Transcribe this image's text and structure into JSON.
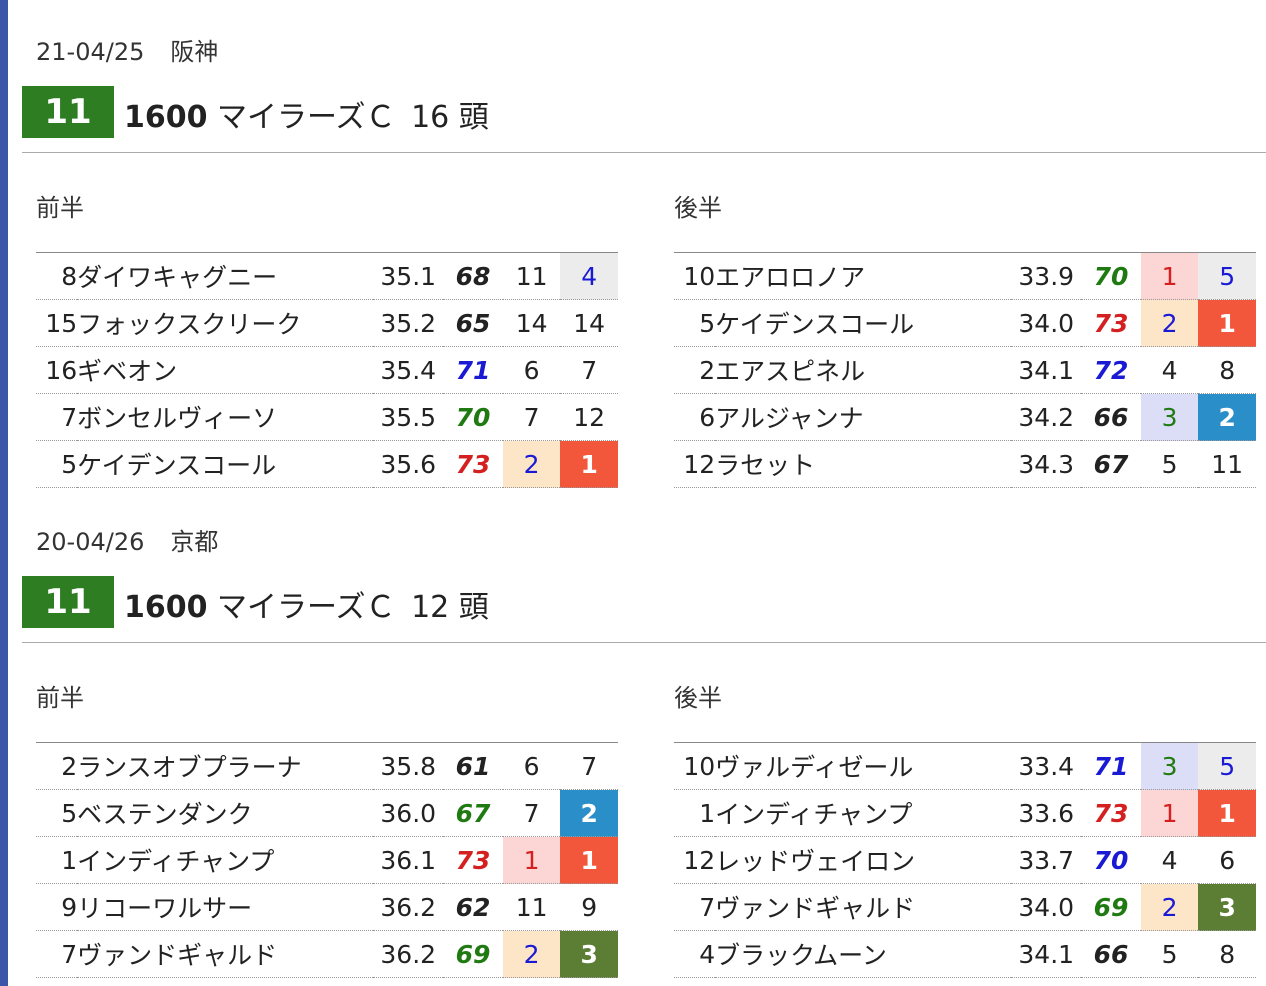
{
  "colors": {
    "race_no_bg": "#2e7d22",
    "left_bar": "#3b55a8",
    "pt_black": "#222222",
    "pt_red": "#d42020",
    "pt_blue": "#1a1ad4",
    "pt_green": "#1f7a12",
    "rank1_bg": "#f2573b",
    "rank2_bg": "#2a8ec8",
    "rank3_bg": "#5b7d34",
    "r1_light_bg": "#fcd6d4",
    "r2_light_bg": "#fde6c8",
    "r3_light_bg": "#dcddf6",
    "r_gray_bg": "#ececec",
    "r1_text": "#d42020",
    "r2_text": "#1a1ad4",
    "r3_text": "#1f7a12",
    "r_gray_text": "#1a1ad4"
  },
  "races": [
    {
      "date": "21-04/25",
      "venue": "阪神",
      "race_no": "11",
      "distance": "1600",
      "name": "マイラーズＣ",
      "heads": "16 頭",
      "first_half_label": "前半",
      "second_half_label": "後半",
      "first_half": [
        {
          "no": "8",
          "name": "ダイワキャグニー",
          "time": "35.1",
          "pt": "68",
          "pt_color": "black",
          "a": "11",
          "a_style": "none",
          "b": "4",
          "b_style": "gray"
        },
        {
          "no": "15",
          "name": "フォックスクリーク",
          "time": "35.2",
          "pt": "65",
          "pt_color": "black",
          "a": "14",
          "a_style": "none",
          "b": "14",
          "b_style": "none"
        },
        {
          "no": "16",
          "name": "ギベオン",
          "time": "35.4",
          "pt": "71",
          "pt_color": "blue",
          "a": "6",
          "a_style": "none",
          "b": "7",
          "b_style": "none"
        },
        {
          "no": "7",
          "name": "ボンセルヴィーソ",
          "time": "35.5",
          "pt": "70",
          "pt_color": "green",
          "a": "7",
          "a_style": "none",
          "b": "12",
          "b_style": "none"
        },
        {
          "no": "5",
          "name": "ケイデンスコール",
          "time": "35.6",
          "pt": "73",
          "pt_color": "red",
          "a": "2",
          "a_style": "light2",
          "b": "1",
          "b_style": "rank1"
        }
      ],
      "second_half": [
        {
          "no": "10",
          "name": "エアロロノア",
          "time": "33.9",
          "pt": "70",
          "pt_color": "green",
          "a": "1",
          "a_style": "light1",
          "b": "5",
          "b_style": "gray"
        },
        {
          "no": "5",
          "name": "ケイデンスコール",
          "time": "34.0",
          "pt": "73",
          "pt_color": "red",
          "a": "2",
          "a_style": "light2",
          "b": "1",
          "b_style": "rank1"
        },
        {
          "no": "2",
          "name": "エアスピネル",
          "time": "34.1",
          "pt": "72",
          "pt_color": "blue",
          "a": "4",
          "a_style": "none",
          "b": "8",
          "b_style": "none"
        },
        {
          "no": "6",
          "name": "アルジャンナ",
          "time": "34.2",
          "pt": "66",
          "pt_color": "black",
          "a": "3",
          "a_style": "light3",
          "b": "2",
          "b_style": "rank2"
        },
        {
          "no": "12",
          "name": "ラセット",
          "time": "34.3",
          "pt": "67",
          "pt_color": "black",
          "a": "5",
          "a_style": "none",
          "b": "11",
          "b_style": "none"
        }
      ]
    },
    {
      "date": "20-04/26",
      "venue": "京都",
      "race_no": "11",
      "distance": "1600",
      "name": "マイラーズＣ",
      "heads": "12 頭",
      "first_half_label": "前半",
      "second_half_label": "後半",
      "first_half": [
        {
          "no": "2",
          "name": "ランスオブプラーナ",
          "time": "35.8",
          "pt": "61",
          "pt_color": "black",
          "a": "6",
          "a_style": "none",
          "b": "7",
          "b_style": "none"
        },
        {
          "no": "5",
          "name": "ベステンダンク",
          "time": "36.0",
          "pt": "67",
          "pt_color": "green",
          "a": "7",
          "a_style": "none",
          "b": "2",
          "b_style": "rank2"
        },
        {
          "no": "1",
          "name": "インディチャンプ",
          "time": "36.1",
          "pt": "73",
          "pt_color": "red",
          "a": "1",
          "a_style": "light1",
          "b": "1",
          "b_style": "rank1"
        },
        {
          "no": "9",
          "name": "リコーワルサー",
          "time": "36.2",
          "pt": "62",
          "pt_color": "black",
          "a": "11",
          "a_style": "none",
          "b": "9",
          "b_style": "none"
        },
        {
          "no": "7",
          "name": "ヴァンドギャルド",
          "time": "36.2",
          "pt": "69",
          "pt_color": "green",
          "a": "2",
          "a_style": "light2",
          "b": "3",
          "b_style": "rank3"
        }
      ],
      "second_half": [
        {
          "no": "10",
          "name": "ヴァルディゼール",
          "time": "33.4",
          "pt": "71",
          "pt_color": "blue",
          "a": "3",
          "a_style": "light3",
          "b": "5",
          "b_style": "gray"
        },
        {
          "no": "1",
          "name": "インディチャンプ",
          "time": "33.6",
          "pt": "73",
          "pt_color": "red",
          "a": "1",
          "a_style": "light1",
          "b": "1",
          "b_style": "rank1"
        },
        {
          "no": "12",
          "name": "レッドヴェイロン",
          "time": "33.7",
          "pt": "70",
          "pt_color": "blue",
          "a": "4",
          "a_style": "none",
          "b": "6",
          "b_style": "none"
        },
        {
          "no": "7",
          "name": "ヴァンドギャルド",
          "time": "34.0",
          "pt": "69",
          "pt_color": "green",
          "a": "2",
          "a_style": "light2",
          "b": "3",
          "b_style": "rank3"
        },
        {
          "no": "4",
          "name": "ブラックムーン",
          "time": "34.1",
          "pt": "66",
          "pt_color": "black",
          "a": "5",
          "a_style": "none",
          "b": "8",
          "b_style": "none"
        }
      ]
    }
  ]
}
